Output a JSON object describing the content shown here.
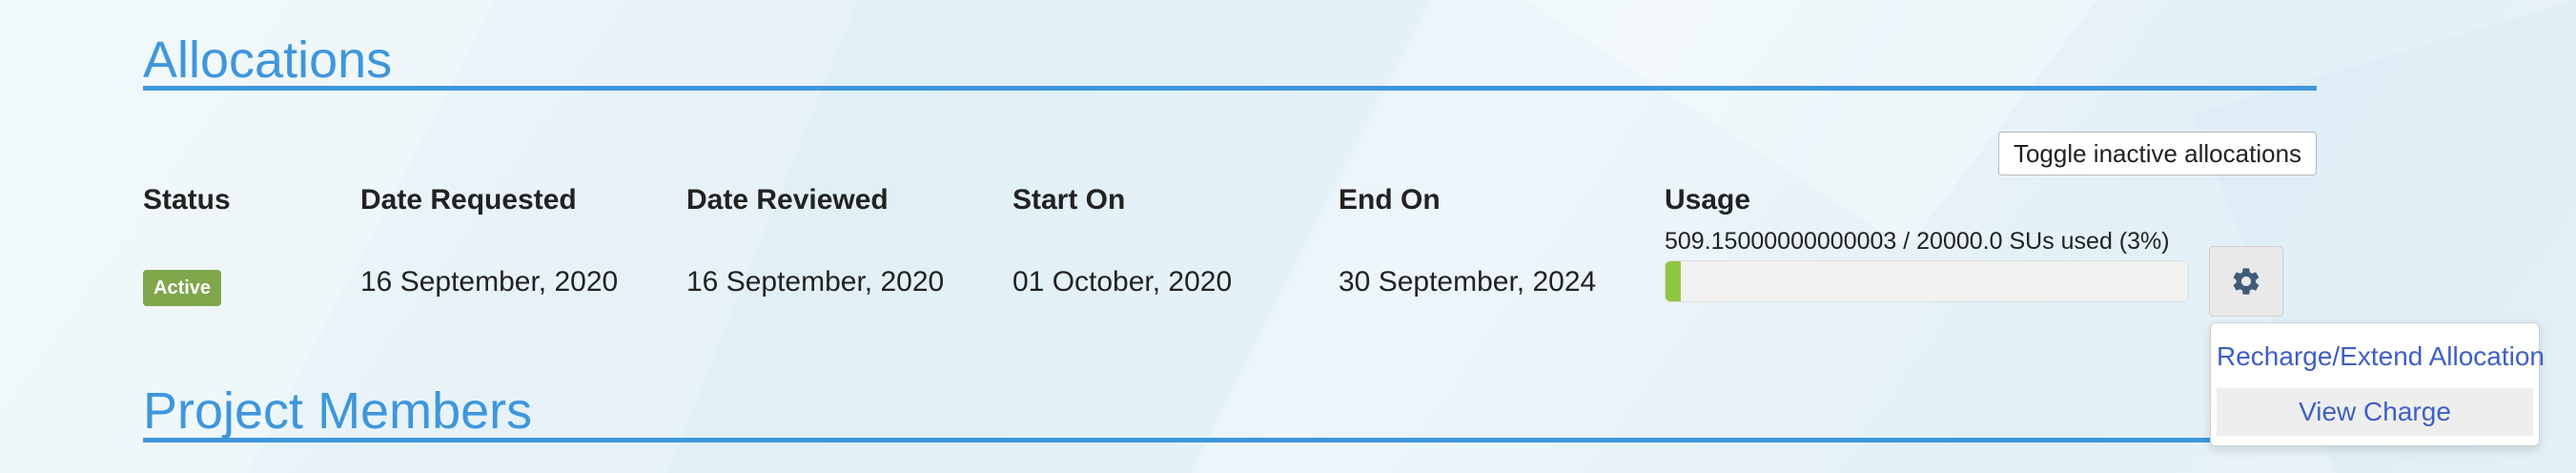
{
  "allocations": {
    "title": "Allocations",
    "toggle_button": "Toggle inactive allocations",
    "headers": {
      "status": "Status",
      "date_requested": "Date Requested",
      "date_reviewed": "Date Reviewed",
      "start_on": "Start On",
      "end_on": "End On",
      "usage": "Usage"
    },
    "row": {
      "status": "Active",
      "date_requested": "16 September, 2020",
      "date_reviewed": "16 September, 2020",
      "start_on": "01 October, 2020",
      "end_on": "30 September, 2024",
      "usage_text": "509.15000000000003 / 20000.0 SUs used (3%)",
      "usage_percent": 3
    },
    "actions_menu": {
      "icon": "gear-icon",
      "items": [
        {
          "label": "Recharge/Extend Allocation"
        },
        {
          "label": "View Charge"
        }
      ]
    }
  },
  "project_members": {
    "title": "Project Members"
  },
  "colors": {
    "heading": "#3f96dc",
    "status_active": "#7fa64a",
    "progress_fill": "#8fc640",
    "link": "#3f5fc4"
  }
}
